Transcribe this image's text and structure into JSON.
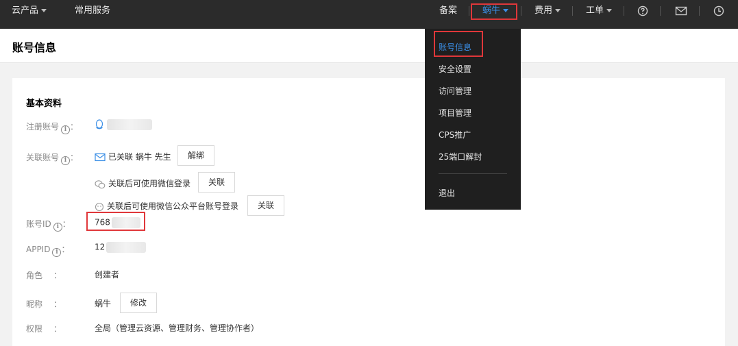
{
  "topbar": {
    "cloud_products": "云产品",
    "common_services": "常用服务",
    "beian": "备案",
    "user_name": "蜗牛",
    "billing": "费用",
    "ticket": "工单"
  },
  "page": {
    "title": "账号信息"
  },
  "profile": {
    "section_title": "基本资料",
    "register_account_label": "注册账号",
    "linked_account_label": "关联账号",
    "linked_email_text": "已关联 蜗牛 先生",
    "unbind_button": "解绑",
    "wechat_text": "关联后可使用微信登录",
    "wechat_link_button": "关联",
    "wechat_mp_text": "关联后可使用微信公众平台账号登录",
    "wechat_mp_link_button": "关联",
    "account_id_label": "账号ID",
    "account_id_value": "768",
    "appid_label": "APPID",
    "appid_value": "12",
    "role_label": "角色",
    "role_value": "创建者",
    "nickname_label": "昵称",
    "nickname_value": "蜗牛",
    "edit_button": "修改",
    "permission_label": "权限",
    "permission_value": "全局（管理云资源、管理财务、管理协作者）",
    "colon": "："
  },
  "dropdown": {
    "items": [
      "账号信息",
      "安全设置",
      "访问管理",
      "项目管理",
      "CPS推广",
      "25端口解封"
    ],
    "logout": "退出"
  },
  "colors": {
    "accent": "#3a8ee6",
    "highlight": "#e0373a",
    "topbar_bg": "#2b2b2b"
  },
  "icons": [
    "help-icon",
    "mail-icon",
    "clock-icon",
    "qq-icon",
    "email-icon",
    "wechat-icon",
    "wechat-mp-icon",
    "info-icon"
  ]
}
